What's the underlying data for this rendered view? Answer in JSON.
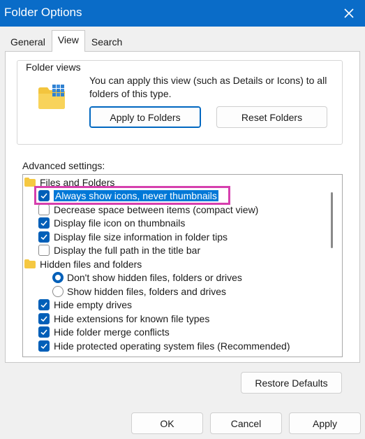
{
  "window": {
    "title": "Folder Options",
    "close_icon": "close-icon"
  },
  "tabs": [
    {
      "label": "General"
    },
    {
      "label": "View",
      "active": true
    },
    {
      "label": "Search"
    }
  ],
  "folder_views": {
    "label": "Folder views",
    "description": "You can apply this view (such as Details or Icons) to all folders of this type.",
    "apply_label": "Apply to Folders",
    "reset_label": "Reset Folders"
  },
  "advanced": {
    "label": "Advanced settings:",
    "items": [
      {
        "type": "folder",
        "text": "Files and Folders"
      },
      {
        "type": "checkbox",
        "checked": true,
        "text": "Always show icons, never thumbnails",
        "selected": true
      },
      {
        "type": "checkbox",
        "checked": false,
        "text": "Decrease space between items (compact view)"
      },
      {
        "type": "checkbox",
        "checked": true,
        "text": "Display file icon on thumbnails"
      },
      {
        "type": "checkbox",
        "checked": true,
        "text": "Display file size information in folder tips"
      },
      {
        "type": "checkbox",
        "checked": false,
        "text": "Display the full path in the title bar"
      },
      {
        "type": "folder",
        "text": "Hidden files and folders"
      },
      {
        "type": "radio",
        "checked": true,
        "text": "Don't show hidden files, folders or drives"
      },
      {
        "type": "radio",
        "checked": false,
        "text": "Show hidden files, folders and drives"
      },
      {
        "type": "checkbox",
        "checked": true,
        "text": "Hide empty drives"
      },
      {
        "type": "checkbox",
        "checked": true,
        "text": "Hide extensions for known file types"
      },
      {
        "type": "checkbox",
        "checked": true,
        "text": "Hide folder merge conflicts"
      },
      {
        "type": "checkbox",
        "checked": true,
        "text": "Hide protected operating system files (Recommended)"
      }
    ]
  },
  "restore_defaults_label": "Restore Defaults",
  "footer": {
    "ok_label": "OK",
    "cancel_label": "Cancel",
    "apply_label": "Apply"
  },
  "colors": {
    "titlebar": "#0a6cc8",
    "accent": "#005fb8",
    "highlight_box": "#d63fae"
  }
}
